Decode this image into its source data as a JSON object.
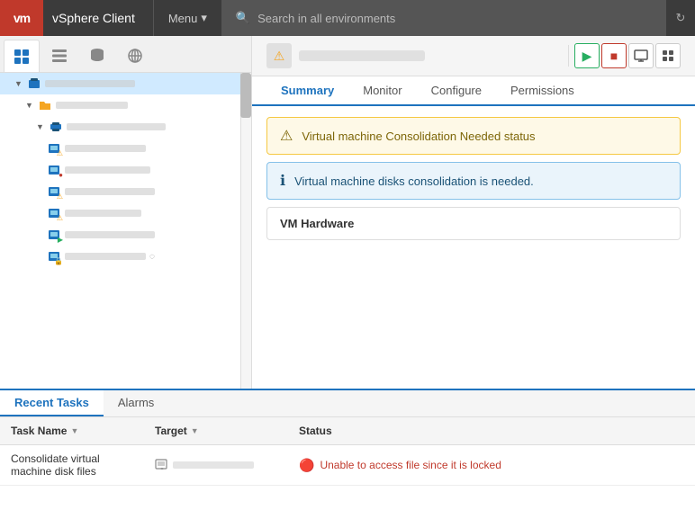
{
  "topbar": {
    "logo": "vm",
    "title": "vSphere Client",
    "menu_label": "Menu",
    "search_placeholder": "Search in all environments"
  },
  "sidebar": {
    "tabs": [
      {
        "id": "home",
        "icon": "⊞",
        "active": true
      },
      {
        "id": "list",
        "icon": "⊟",
        "active": false
      },
      {
        "id": "db",
        "icon": "🗄",
        "active": false
      },
      {
        "id": "globe",
        "icon": "🌐",
        "active": false
      }
    ]
  },
  "content_header": {
    "warning_icon": "⚠",
    "actions": {
      "play": "▶",
      "stop": "■",
      "monitor": "🖥",
      "settings": "⚙"
    }
  },
  "tabs": [
    {
      "id": "summary",
      "label": "Summary",
      "active": true
    },
    {
      "id": "monitor",
      "label": "Monitor",
      "active": false
    },
    {
      "id": "configure",
      "label": "Configure",
      "active": false
    },
    {
      "id": "permissions",
      "label": "Permissions",
      "active": false
    }
  ],
  "alerts": [
    {
      "type": "warning",
      "icon": "⚠",
      "text": "Virtual machine Consolidation Needed status"
    },
    {
      "type": "info",
      "icon": "ℹ",
      "text": "Virtual machine disks consolidation is needed."
    }
  ],
  "vm_hardware": {
    "label": "VM Hardware"
  },
  "bottom_panel": {
    "tabs": [
      {
        "id": "recent-tasks",
        "label": "Recent Tasks",
        "active": true
      },
      {
        "id": "alarms",
        "label": "Alarms",
        "active": false
      }
    ],
    "table_headers": [
      {
        "id": "task-name",
        "label": "Task Name",
        "sortable": true
      },
      {
        "id": "target",
        "label": "Target",
        "sortable": true
      },
      {
        "id": "status",
        "label": "Status",
        "sortable": false
      }
    ],
    "rows": [
      {
        "task_name_line1": "Consolidate virtual",
        "task_name_line2": "machine disk files",
        "target_blurred": true,
        "status_type": "error",
        "status_icon": "🔴",
        "status_text": "Unable to access file since it is locked"
      }
    ]
  }
}
